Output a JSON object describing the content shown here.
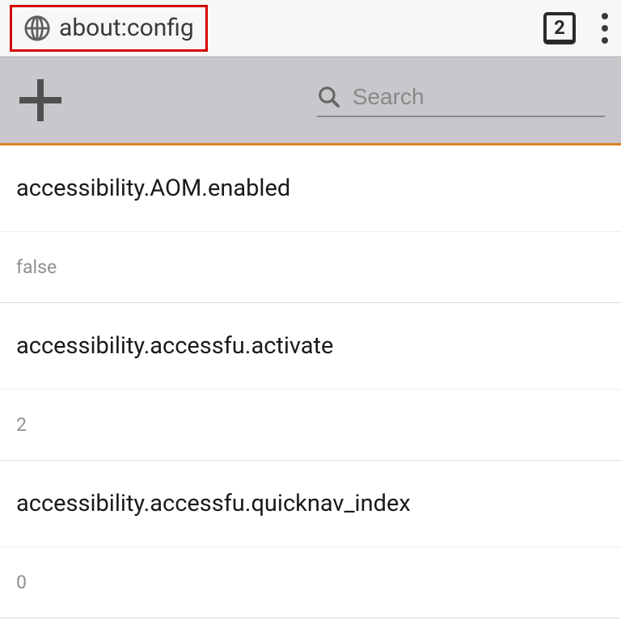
{
  "header": {
    "url": "about:config",
    "tab_count": "2"
  },
  "search": {
    "placeholder": "Search"
  },
  "prefs": [
    {
      "name": "accessibility.AOM.enabled",
      "value": "false"
    },
    {
      "name": "accessibility.accessfu.activate",
      "value": "2"
    },
    {
      "name": "accessibility.accessfu.quicknav_index",
      "value": "0"
    }
  ]
}
